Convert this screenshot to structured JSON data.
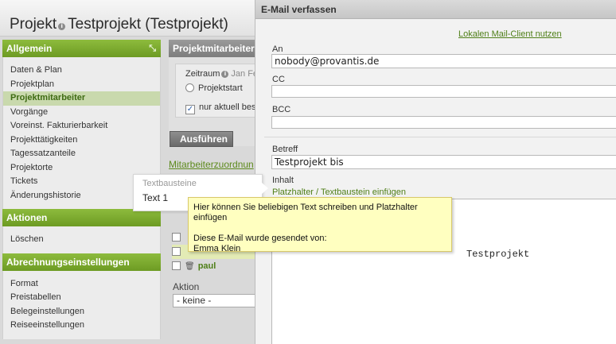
{
  "header": {
    "title_prefix": "Projekt",
    "title_name": "Testprojekt (Testprojekt)"
  },
  "sidebar": {
    "sections": [
      {
        "label": "Allgemein",
        "items": [
          "Daten & Plan",
          "Projektplan",
          "Projektmitarbeiter",
          "Vorgänge",
          "Voreinst. Fakturierbarkeit",
          "Projekttätigkeiten",
          "Tagessatzanteile",
          "Projektorte",
          "Tickets",
          "Änderungshistorie"
        ]
      },
      {
        "label": "Aktionen",
        "items": [
          "Löschen"
        ]
      },
      {
        "label": "Abrechnungseinstellungen",
        "items": [
          "Format",
          "Preistabellen",
          "Belegeinstellungen",
          "Reiseeinstellungen"
        ]
      }
    ],
    "active_item": "Projektmitarbeiter"
  },
  "main": {
    "panel_title": "Projektmitarbeiter",
    "filter": {
      "zeitraum_label": "Zeitraum",
      "zeitraum_value": "Jan Fe",
      "radio_label": "Projektstart",
      "checkbox_label": "nur aktuell bes",
      "checkbox_checked": true
    },
    "run_button": "Ausführen",
    "assign_link": "Mitarbeiterzuordnun",
    "rows": [
      {
        "label": "",
        "highlight": false
      },
      {
        "label": "",
        "highlight": true
      },
      {
        "label": "paul",
        "highlight": false
      }
    ],
    "action_label": "Aktion",
    "action_select": "- keine -"
  },
  "popover": {
    "title": "Textbausteine",
    "item": "Text 1"
  },
  "dialog": {
    "title": "E-Mail verfassen",
    "mail_client_link": "Lokalen Mail-Client nutzen",
    "to_label": "An",
    "to_value": "nobody@provantis.de",
    "cc_label": "CC",
    "cc_value": "",
    "bcc_label": "BCC",
    "bcc_value": "",
    "subject_label": "Betreff",
    "subject_value": "Testprojekt bis",
    "body_label": "Inhalt",
    "placeholder_link": "Platzhalter / Textbaustein einfügen",
    "body_text": "Testprojekt"
  },
  "tooltip": {
    "line1": "Hier können Sie beliebigen Text schreiben und Platzhalter einfügen",
    "line2": "Diese E-Mail wurde gesendet von:",
    "line3": "Emma Klein"
  },
  "colors": {
    "accent_green": "#7aa92e",
    "link_green": "#4f7f18",
    "tooltip_bg": "#ffffc0"
  }
}
